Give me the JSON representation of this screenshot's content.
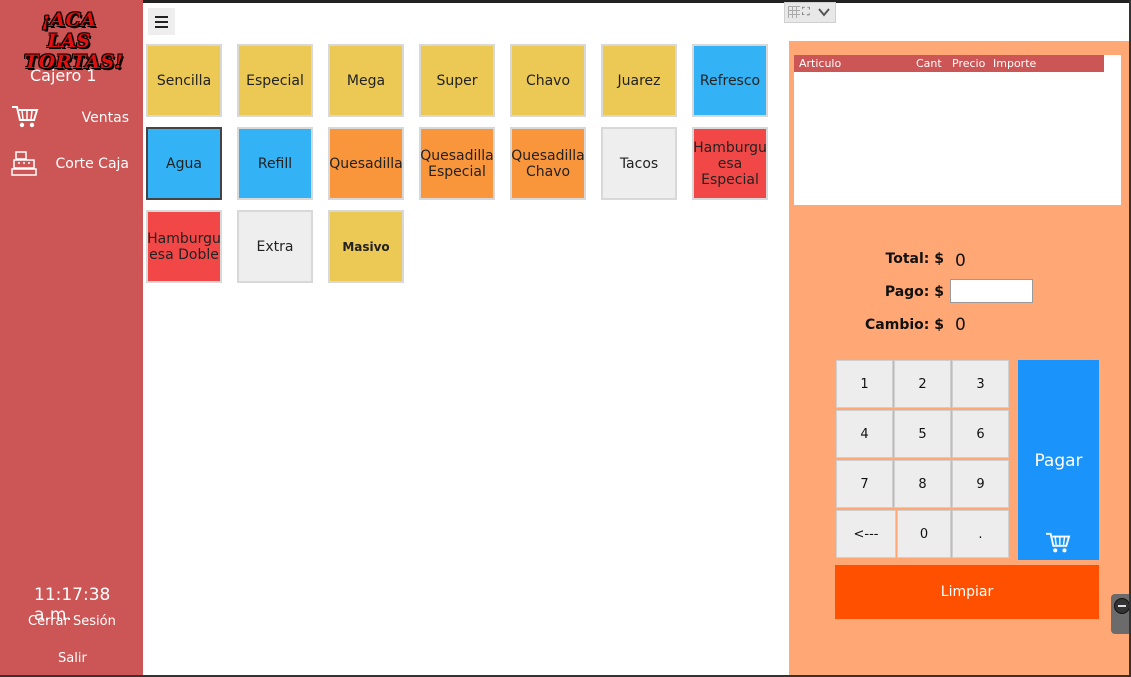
{
  "app": {
    "logo_line1": "¡ACA LAS",
    "logo_line2": "TORTAS!",
    "cashier": "Cajero 1"
  },
  "sidebar": {
    "items": [
      {
        "label": "Ventas",
        "icon": "shopping-cart-icon"
      },
      {
        "label": "Corte Caja",
        "icon": "cash-register-icon"
      }
    ],
    "time": "11:17:38 a.m.",
    "logout_label": "Cerrar Sesión",
    "exit_label": "Salir"
  },
  "products": {
    "row1": [
      {
        "label": "Sencilla",
        "color": "#ecc955"
      },
      {
        "label": "Especial",
        "color": "#ecc955"
      },
      {
        "label": "Mega",
        "color": "#ecc955"
      },
      {
        "label": "Super",
        "color": "#ecc955"
      },
      {
        "label": "Chavo",
        "color": "#ecc955"
      },
      {
        "label": "Juarez",
        "color": "#ecc955"
      },
      {
        "label": "Refresco",
        "color": "#33b3f5"
      }
    ],
    "row2": [
      {
        "label": "Agua",
        "color": "#33b3f5"
      },
      {
        "label": "Refill",
        "color": "#33b3f5"
      },
      {
        "label": "Quesadilla",
        "color": "#f9963c"
      },
      {
        "label_line1": "Quesadilla",
        "label_line2": "Especial",
        "color": "#f9963c"
      },
      {
        "label_line1": "Quesadilla",
        "label_line2": "Chavo",
        "color": "#f9963c"
      },
      {
        "label": "Tacos",
        "color": "#eeeeee"
      },
      {
        "label_line1": "Hamburgu",
        "label_line2": "esa",
        "label_line3": "Especial",
        "color": "#f24747"
      }
    ],
    "row3": [
      {
        "label_line1": "Hamburgu",
        "label_line2": "esa Doble",
        "color": "#f24747"
      },
      {
        "label": "Extra",
        "color": "#eeeeee"
      },
      {
        "label": "Masivo",
        "color": "#ecc955"
      }
    ]
  },
  "ticket": {
    "columns": [
      "Articulo",
      "Cant",
      "Precio",
      "Importe"
    ],
    "rows": []
  },
  "totals": {
    "total_label": "Total: $",
    "total_value": "0",
    "payment_label": "Pago: $",
    "payment_value": "",
    "change_label": "Cambio: $",
    "change_value": "0"
  },
  "keypad": {
    "keys": [
      "1",
      "2",
      "3",
      "4",
      "5",
      "6",
      "7",
      "8",
      "9",
      "<---",
      "0",
      "."
    ],
    "pay_label": "Pagar",
    "clear_label": "Limpiar"
  },
  "colors": {
    "sidebar": "#cc5555",
    "panel": "#ffa875",
    "pay": "#1a94fb",
    "clear": "#ff5000"
  }
}
